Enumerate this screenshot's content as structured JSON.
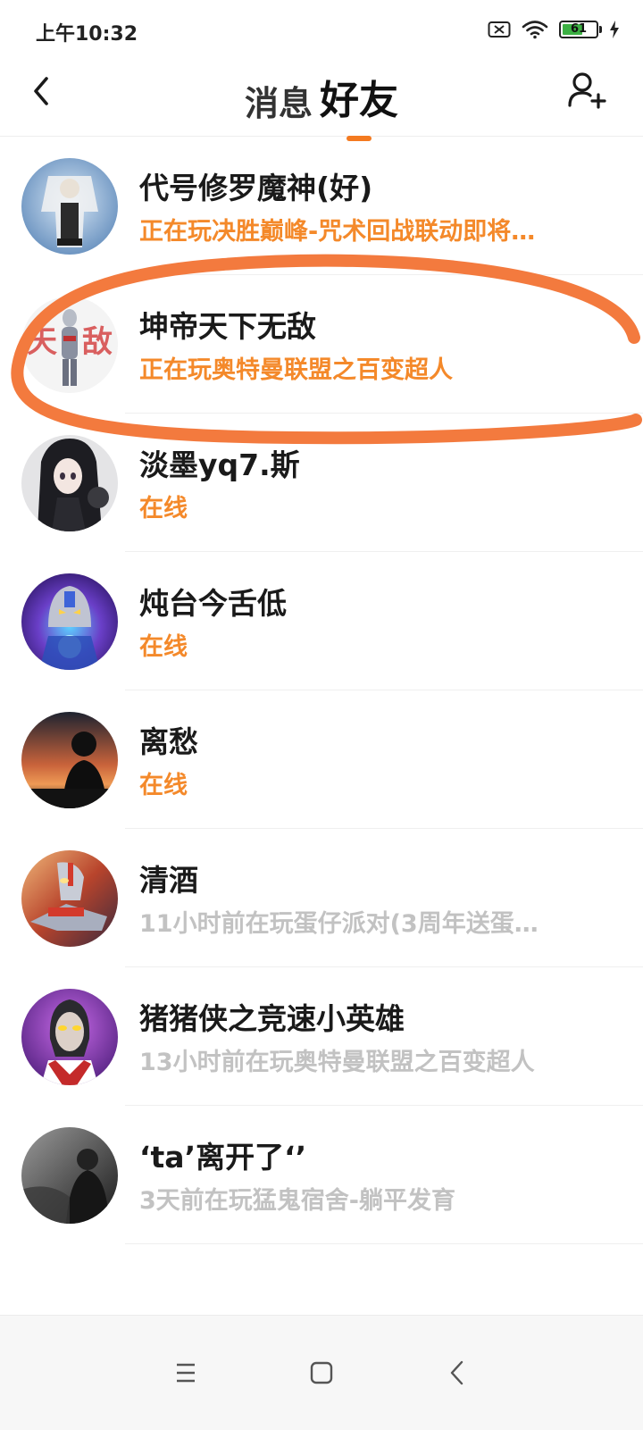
{
  "status_bar": {
    "time": "上午10:32",
    "battery": "61",
    "battery_level": 0.61
  },
  "header": {
    "tab_messages": "消息",
    "tab_friends": "好友",
    "active_tab": "好友",
    "accent_color": "#f47a20"
  },
  "friends": [
    {
      "name": "代号修罗魔神(好)",
      "status": "正在玩决胜巅峰-咒术回战联动即将…",
      "state": "playing"
    },
    {
      "name": "坤帝天下无敌",
      "status": "正在玩奥特曼联盟之百变超人",
      "state": "playing"
    },
    {
      "name": "淡墨yq7.斯",
      "status": "在线",
      "state": "online"
    },
    {
      "name": "炖台今舌低",
      "status": "在线",
      "state": "online"
    },
    {
      "name": "离愁",
      "status": "在线",
      "state": "online"
    },
    {
      "name": "清酒",
      "status": "11小时前在玩蛋仔派对(3周年送蛋…",
      "state": "offline"
    },
    {
      "name": "猪猪侠之竞速小英雄",
      "status": "13小时前在玩奥特曼联盟之百变超人",
      "state": "offline"
    },
    {
      "name": "‘ta’离开了‘’",
      "status": "3天前在玩猛鬼宿舍-躺平发育",
      "state": "offline"
    }
  ],
  "colors": {
    "playing": "#f4892a",
    "online": "#f4892a",
    "offline": "#c2c2c2",
    "annotation": "#f37a3e"
  },
  "icons": {
    "back": "back-arrow-icon",
    "add_friend": "add-user-icon",
    "nav_menu": "menu-icon",
    "nav_home": "home-square-icon",
    "nav_back": "back-chevron-icon"
  }
}
